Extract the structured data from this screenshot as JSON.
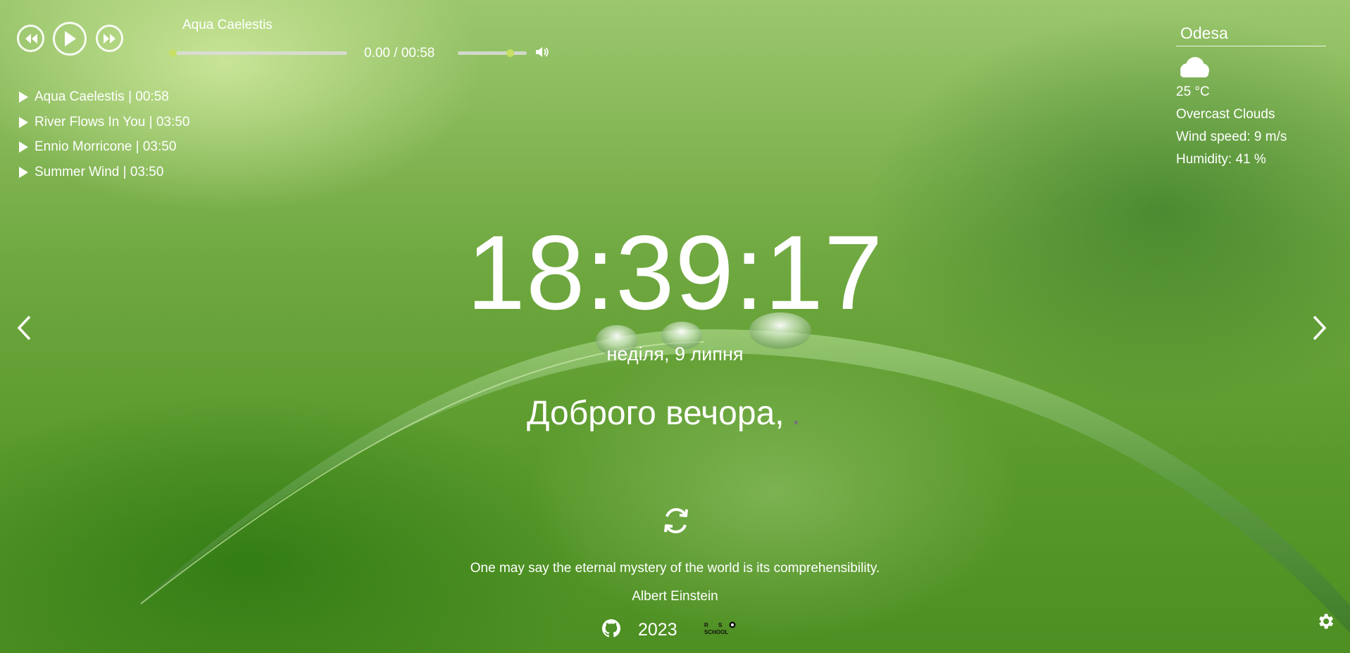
{
  "player": {
    "current_title": "Aqua Caelestis",
    "progress_fraction": 0.0,
    "time": "0.00 / 00:58",
    "volume_fraction": 0.76,
    "playlist": [
      {
        "label": "Aqua Caelestis | 00:58"
      },
      {
        "label": "River Flows In You | 03:50"
      },
      {
        "label": "Ennio Morricone | 03:50"
      },
      {
        "label": "Summer Wind | 03:50"
      }
    ]
  },
  "weather": {
    "city": "Odesa",
    "icon": "cloud-icon",
    "temperature": "25 °C",
    "description": "Overcast Clouds",
    "wind": "Wind speed: 9 m/s",
    "humidity": "Humidity: 41 %"
  },
  "clock": {
    "time": "18:39:17",
    "date": "неділя, 9 липня"
  },
  "greeting": {
    "text": "Доброго вечора,",
    "name_placeholder": "."
  },
  "quote": {
    "text": "One may say the eternal mystery of the world is its comprehensibility.",
    "author": "Albert Einstein"
  },
  "footer": {
    "year": "2023",
    "github_icon": "github-icon",
    "school_logo": "rs-school-logo"
  },
  "colors": {
    "accent": "#c5e065",
    "text": "#ffffff"
  }
}
